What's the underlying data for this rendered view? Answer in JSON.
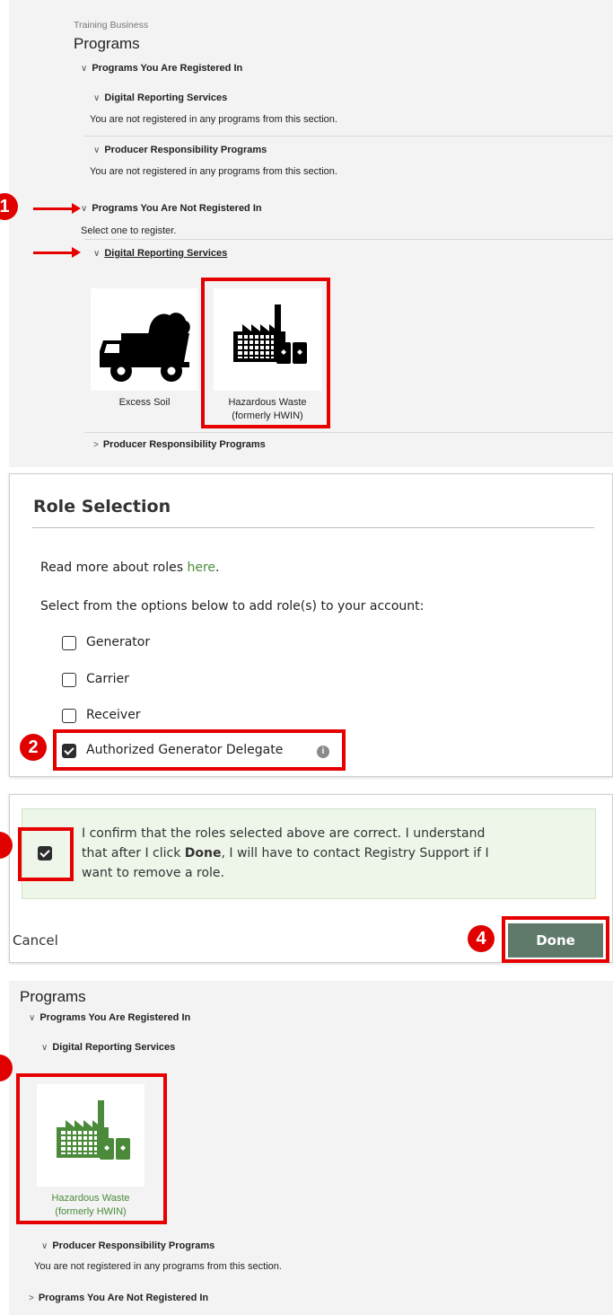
{
  "panel1": {
    "breadcrumb": "Training Business",
    "title": "Programs",
    "registered_header": "Programs You Are Registered In",
    "drs_header": "Digital Reporting Services",
    "drs_empty": "You are not registered in any programs from this section.",
    "prp_header": "Producer Responsibility Programs",
    "prp_empty": "You are not registered in any programs from this section.",
    "not_registered_header": "Programs You Are Not Registered In",
    "select_one": "Select one to register.",
    "drs_link": "Digital Reporting Services",
    "tile_excess_soil": "Excess Soil",
    "tile_hw_line1": "Hazardous Waste",
    "tile_hw_line2": "(formerly HWIN)",
    "prp_collapsed": "Producer Responsibility Programs",
    "step_badge": "1"
  },
  "role_dialog": {
    "title": "Role Selection",
    "read_more_prefix": "Read more about roles ",
    "read_more_link": "here",
    "read_more_suffix": ".",
    "instruction": "Select from the options below to add role(s) to your account:",
    "roles": [
      {
        "label": "Generator",
        "checked": false
      },
      {
        "label": "Carrier",
        "checked": false
      },
      {
        "label": "Receiver",
        "checked": false
      },
      {
        "label": "Authorized Generator Delegate",
        "checked": true
      }
    ],
    "step_badge": "2"
  },
  "confirm": {
    "text_1": "I confirm that the roles selected above are correct. I understand",
    "text_2a": "that after I click ",
    "text_2b": "Done",
    "text_2c": ", I will have to contact Registry Support if I",
    "text_3": "want to remove a role.",
    "cancel_label": "Cancel",
    "done_label": "Done",
    "step_badge_4": "4"
  },
  "panel3": {
    "title": "Programs",
    "registered_header": "Programs You Are Registered In",
    "drs_header": "Digital Reporting Services",
    "tile_hw_line1": "Hazardous Waste",
    "tile_hw_line2": "(formerly HWIN)",
    "prp_header": "Producer Responsibility Programs",
    "prp_empty": "You are not registered in any programs from this section.",
    "not_registered_header": "Programs You Are Not Registered In"
  },
  "colors": {
    "annotation_red": "#e60000",
    "green_accent": "#4a8a3a",
    "done_button": "#5f7a6b",
    "confirm_bg": "#eef6ea"
  },
  "icons": {
    "truck": "dump-truck-icon",
    "factory": "factory-icon"
  }
}
